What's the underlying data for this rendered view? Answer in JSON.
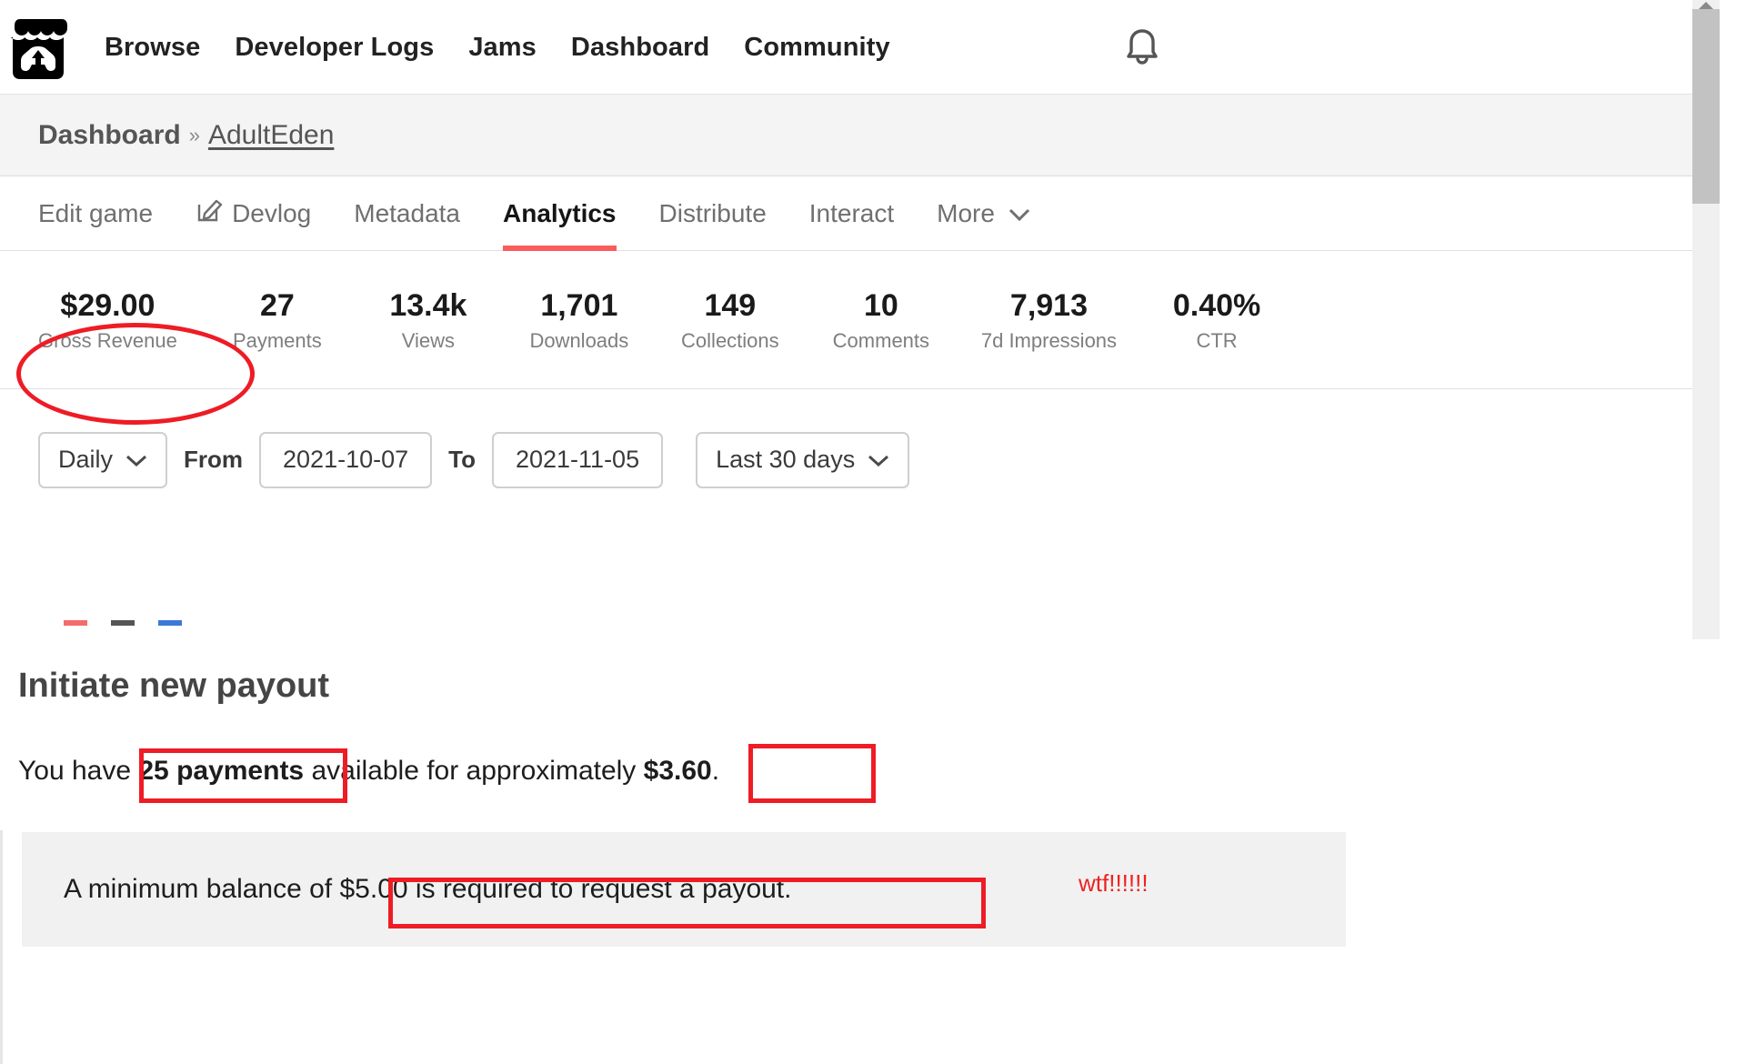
{
  "site": {
    "logo_icon": "itchio-storefront-gamepad-logo",
    "nav": [
      {
        "label": "Browse"
      },
      {
        "label": "Developer Logs"
      },
      {
        "label": "Jams"
      },
      {
        "label": "Dashboard"
      },
      {
        "label": "Community"
      }
    ],
    "bell_icon": "bell-icon"
  },
  "breadcrumb": {
    "root": "Dashboard",
    "separator": "»",
    "current": "AdultEden"
  },
  "tabs": [
    {
      "label": "Edit game",
      "active": false,
      "icon": null
    },
    {
      "label": "Devlog",
      "active": false,
      "icon": "pencil-edit-icon"
    },
    {
      "label": "Metadata",
      "active": false,
      "icon": null
    },
    {
      "label": "Analytics",
      "active": true,
      "icon": null
    },
    {
      "label": "Distribute",
      "active": false,
      "icon": null
    },
    {
      "label": "Interact",
      "active": false,
      "icon": null
    },
    {
      "label": "More",
      "active": false,
      "icon": "chevron-down-icon"
    }
  ],
  "stats": [
    {
      "value": "$29.00",
      "label": "Gross Revenue"
    },
    {
      "value": "27",
      "label": "Payments"
    },
    {
      "value": "13.4k",
      "label": "Views"
    },
    {
      "value": "1,701",
      "label": "Downloads"
    },
    {
      "value": "149",
      "label": "Collections"
    },
    {
      "value": "10",
      "label": "Comments"
    },
    {
      "value": "7,913",
      "label": "7d Impressions"
    },
    {
      "value": "0.40%",
      "label": "CTR"
    }
  ],
  "filters": {
    "granularity": "Daily",
    "from_label": "From",
    "from_value": "2021-10-07",
    "to_label": "To",
    "to_value": "2021-11-05",
    "range_preset": "Last 30 days"
  },
  "payout": {
    "title": "Initiate new payout",
    "sentence_prefix": "You have ",
    "payments_count": "25 payments",
    "sentence_middle": " available for approximately ",
    "amount": "$3.60",
    "sentence_suffix": ".",
    "notice_prefix": "A minimum balance of ",
    "notice_min": "$5.00",
    "notice_suffix": " is required to request a payout."
  },
  "annotations": {
    "color": "#ee1c25",
    "handwritten_note": "wtf!!!!!!",
    "ellipse_target": "Gross Revenue stat",
    "boxes": [
      "25 payments",
      "$3.60.",
      "$5.00 is required to request a payout."
    ]
  },
  "theme": {
    "accent_red": "#fa5c5c",
    "annotation_red": "#ee1c25",
    "band_gray": "#f4f4f4",
    "notice_gray": "#f1f1f1"
  }
}
